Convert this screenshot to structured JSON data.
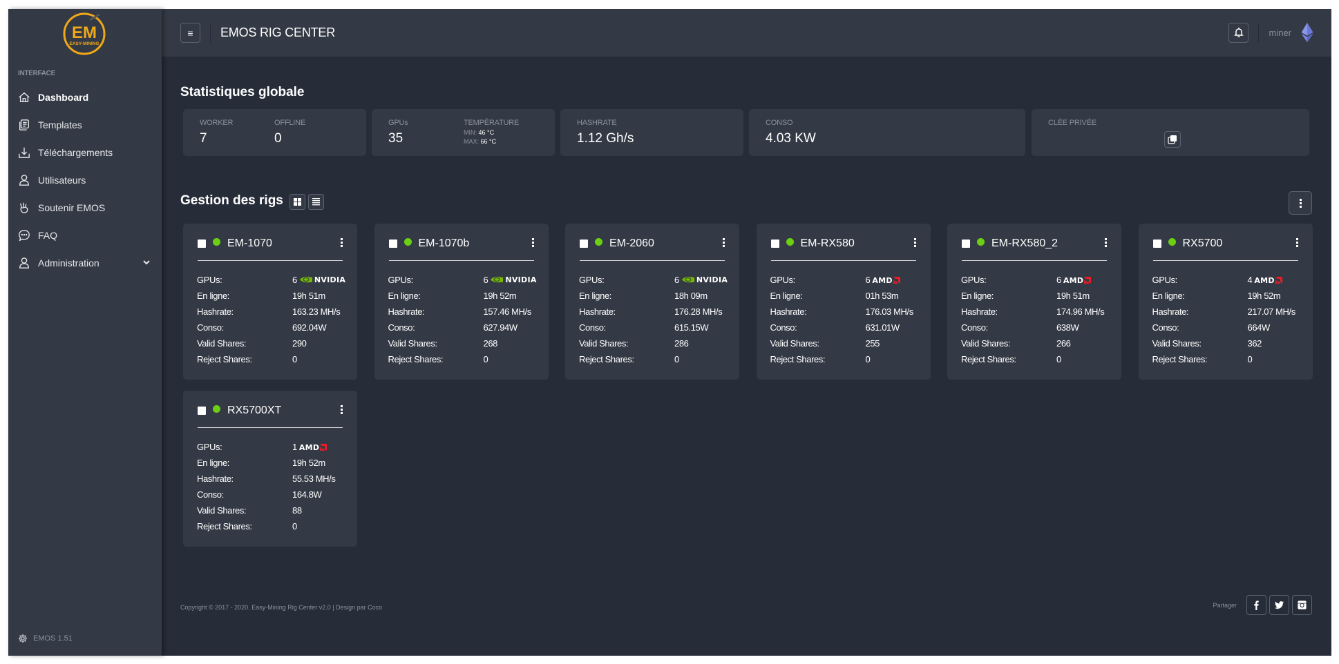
{
  "app": {
    "title": "EMOS RIG CENTER",
    "logo_text": "EM",
    "logo_subtext": "EASY-MINING"
  },
  "sidebar": {
    "section_label": "INTERFACE",
    "items": [
      {
        "label": "Dashboard",
        "icon": "home-icon",
        "active": true
      },
      {
        "label": "Templates",
        "icon": "templates-icon"
      },
      {
        "label": "Téléchargements",
        "icon": "download-icon"
      },
      {
        "label": "Utilisateurs",
        "icon": "user-icon"
      },
      {
        "label": "Soutenir EMOS",
        "icon": "peace-hand-icon"
      },
      {
        "label": "FAQ",
        "icon": "chat-icon"
      },
      {
        "label": "Administration",
        "icon": "user-icon",
        "expandable": true
      }
    ],
    "version": "EMOS 1.51"
  },
  "topbar": {
    "menu_icon": "≡",
    "user_name": "miner"
  },
  "stats": {
    "title": "Statistiques globale",
    "worker_label": "WORKER",
    "worker_value": "7",
    "offline_label": "OFFLINE",
    "offline_value": "0",
    "gpus_label": "GPUs",
    "gpus_value": "35",
    "temp_label": "TEMPÉRATURE",
    "temp_min_label": "MIN:",
    "temp_min_value": "46 °C",
    "temp_max_label": "MAX:",
    "temp_max_value": "66 °C",
    "hashrate_label": "HASHRATE",
    "hashrate_value": "1.12 Gh/s",
    "conso_label": "CONSO",
    "conso_value": "4.03 KW",
    "key_label": "CLÉE PRIVÉE"
  },
  "rigs": {
    "title": "Gestion des rigs",
    "row_labels": {
      "gpus": "GPUs:",
      "online": "En ligne:",
      "hashrate": "Hashrate:",
      "conso": "Conso:",
      "valid": "Valid Shares:",
      "reject": "Reject Shares:"
    },
    "status_color": "#6ccf13",
    "items": [
      {
        "name": "EM-1070",
        "gpus": "6",
        "vendor": "NVIDIA",
        "online": "19h 51m",
        "hashrate": "163.23 MH/s",
        "conso": "692.04W",
        "valid": "290",
        "reject": "0"
      },
      {
        "name": "EM-1070b",
        "gpus": "6",
        "vendor": "NVIDIA",
        "online": "19h 52m",
        "hashrate": "157.46 MH/s",
        "conso": "627.94W",
        "valid": "268",
        "reject": "0"
      },
      {
        "name": "EM-2060",
        "gpus": "6",
        "vendor": "NVIDIA",
        "online": "18h 09m",
        "hashrate": "176.28 MH/s",
        "conso": "615.15W",
        "valid": "286",
        "reject": "0"
      },
      {
        "name": "EM-RX580",
        "gpus": "6",
        "vendor": "AMD",
        "online": "01h 53m",
        "hashrate": "176.03 MH/s",
        "conso": "631.01W",
        "valid": "255",
        "reject": "0"
      },
      {
        "name": "EM-RX580_2",
        "gpus": "6",
        "vendor": "AMD",
        "online": "19h 51m",
        "hashrate": "174.96 MH/s",
        "conso": "638W",
        "valid": "266",
        "reject": "0"
      },
      {
        "name": "RX5700",
        "gpus": "4",
        "vendor": "AMD",
        "online": "19h 52m",
        "hashrate": "217.07 MH/s",
        "conso": "664W",
        "valid": "362",
        "reject": "0"
      },
      {
        "name": "RX5700XT",
        "gpus": "1",
        "vendor": "AMD",
        "online": "19h 52m",
        "hashrate": "55.53 MH/s",
        "conso": "164.8W",
        "valid": "88",
        "reject": "0"
      }
    ]
  },
  "footer": {
    "copyright": "Copyright © 2017 - 2020. Easy-Mining Rig Center v2.0 | Design par Coco",
    "share_label": "Partager",
    "social": [
      "facebook",
      "twitter",
      "instagram"
    ]
  },
  "colors": {
    "accent_logo": "#f0a818",
    "nvidia_green": "#76b900",
    "amd_red": "#ed1c24",
    "eth_purple": "#7b8ae0"
  }
}
